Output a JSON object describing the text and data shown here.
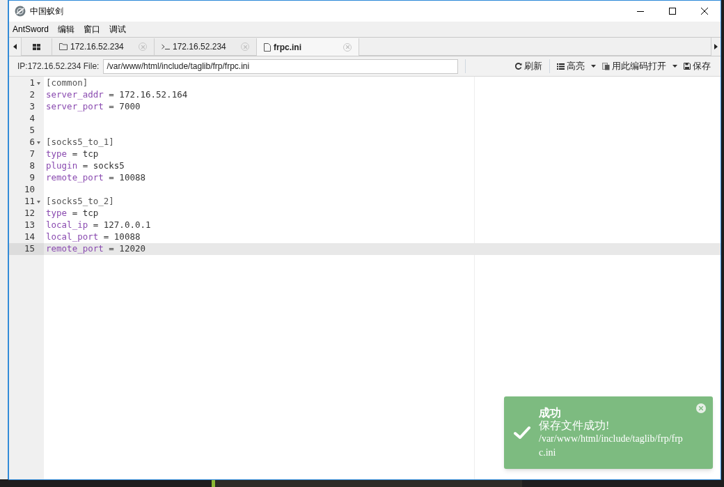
{
  "window": {
    "title": "中国蚁剑"
  },
  "menu": [
    "AntSword",
    "编辑",
    "窗口",
    "调试"
  ],
  "tabs": [
    {
      "kind": "grid",
      "selected": false
    },
    {
      "kind": "folder",
      "label": "172.16.52.234",
      "selected": false
    },
    {
      "kind": "terminal",
      "label": "172.16.52.234",
      "selected": false
    },
    {
      "kind": "file",
      "label": "frpc.ini",
      "selected": true
    }
  ],
  "toolbar": {
    "label": "IP:172.16.52.234 File:",
    "path": "/var/www/html/include/taglib/frp/frpc.ini",
    "buttons": [
      {
        "kind": "refresh",
        "label": "刷新",
        "dropdown": false
      },
      {
        "kind": "list",
        "label": "高亮",
        "dropdown": true
      },
      {
        "kind": "encoding",
        "label": "用此编码打开",
        "dropdown": true
      },
      {
        "kind": "save",
        "label": "保存",
        "dropdown": false
      }
    ]
  },
  "editor": {
    "lines": [
      {
        "number": "1",
        "kind": "section",
        "text": "[common]",
        "foldable": true,
        "active": false
      },
      {
        "number": "2",
        "kind": "pair",
        "key": "server_addr",
        "rest": " = 172.16.52.164",
        "foldable": false,
        "active": false
      },
      {
        "number": "3",
        "kind": "pair",
        "key": "server_port",
        "rest": " = 7000",
        "foldable": false,
        "active": false
      },
      {
        "number": "4",
        "kind": "blank",
        "foldable": false,
        "active": false
      },
      {
        "number": "5",
        "kind": "blank",
        "foldable": false,
        "active": false
      },
      {
        "number": "6",
        "kind": "section",
        "text": "[socks5_to_1]",
        "foldable": true,
        "active": false
      },
      {
        "number": "7",
        "kind": "pair",
        "key": "type",
        "rest": " = tcp",
        "foldable": false,
        "active": false
      },
      {
        "number": "8",
        "kind": "pair",
        "key": "plugin",
        "rest": " = socks5",
        "foldable": false,
        "active": false
      },
      {
        "number": "9",
        "kind": "pair",
        "key": "remote_port",
        "rest": " = 10088",
        "foldable": false,
        "active": false
      },
      {
        "number": "10",
        "kind": "blank",
        "foldable": false,
        "active": false
      },
      {
        "number": "11",
        "kind": "section",
        "text": "[socks5_to_2]",
        "foldable": true,
        "active": false
      },
      {
        "number": "12",
        "kind": "pair",
        "key": "type",
        "rest": " = tcp",
        "foldable": false,
        "active": false
      },
      {
        "number": "13",
        "kind": "pair",
        "key": "local_ip",
        "rest": " = 127.0.0.1",
        "foldable": false,
        "active": false
      },
      {
        "number": "14",
        "kind": "pair",
        "key": "local_port",
        "rest": " = 10088",
        "foldable": false,
        "active": false
      },
      {
        "number": "15",
        "kind": "pair",
        "key": "remote_port",
        "rest": " = 12020",
        "foldable": false,
        "active": true
      }
    ]
  },
  "toast": {
    "title": "成功",
    "message": "保存文件成功!",
    "path": "/var/www/html/include/taglib/frp/frpc.ini"
  }
}
